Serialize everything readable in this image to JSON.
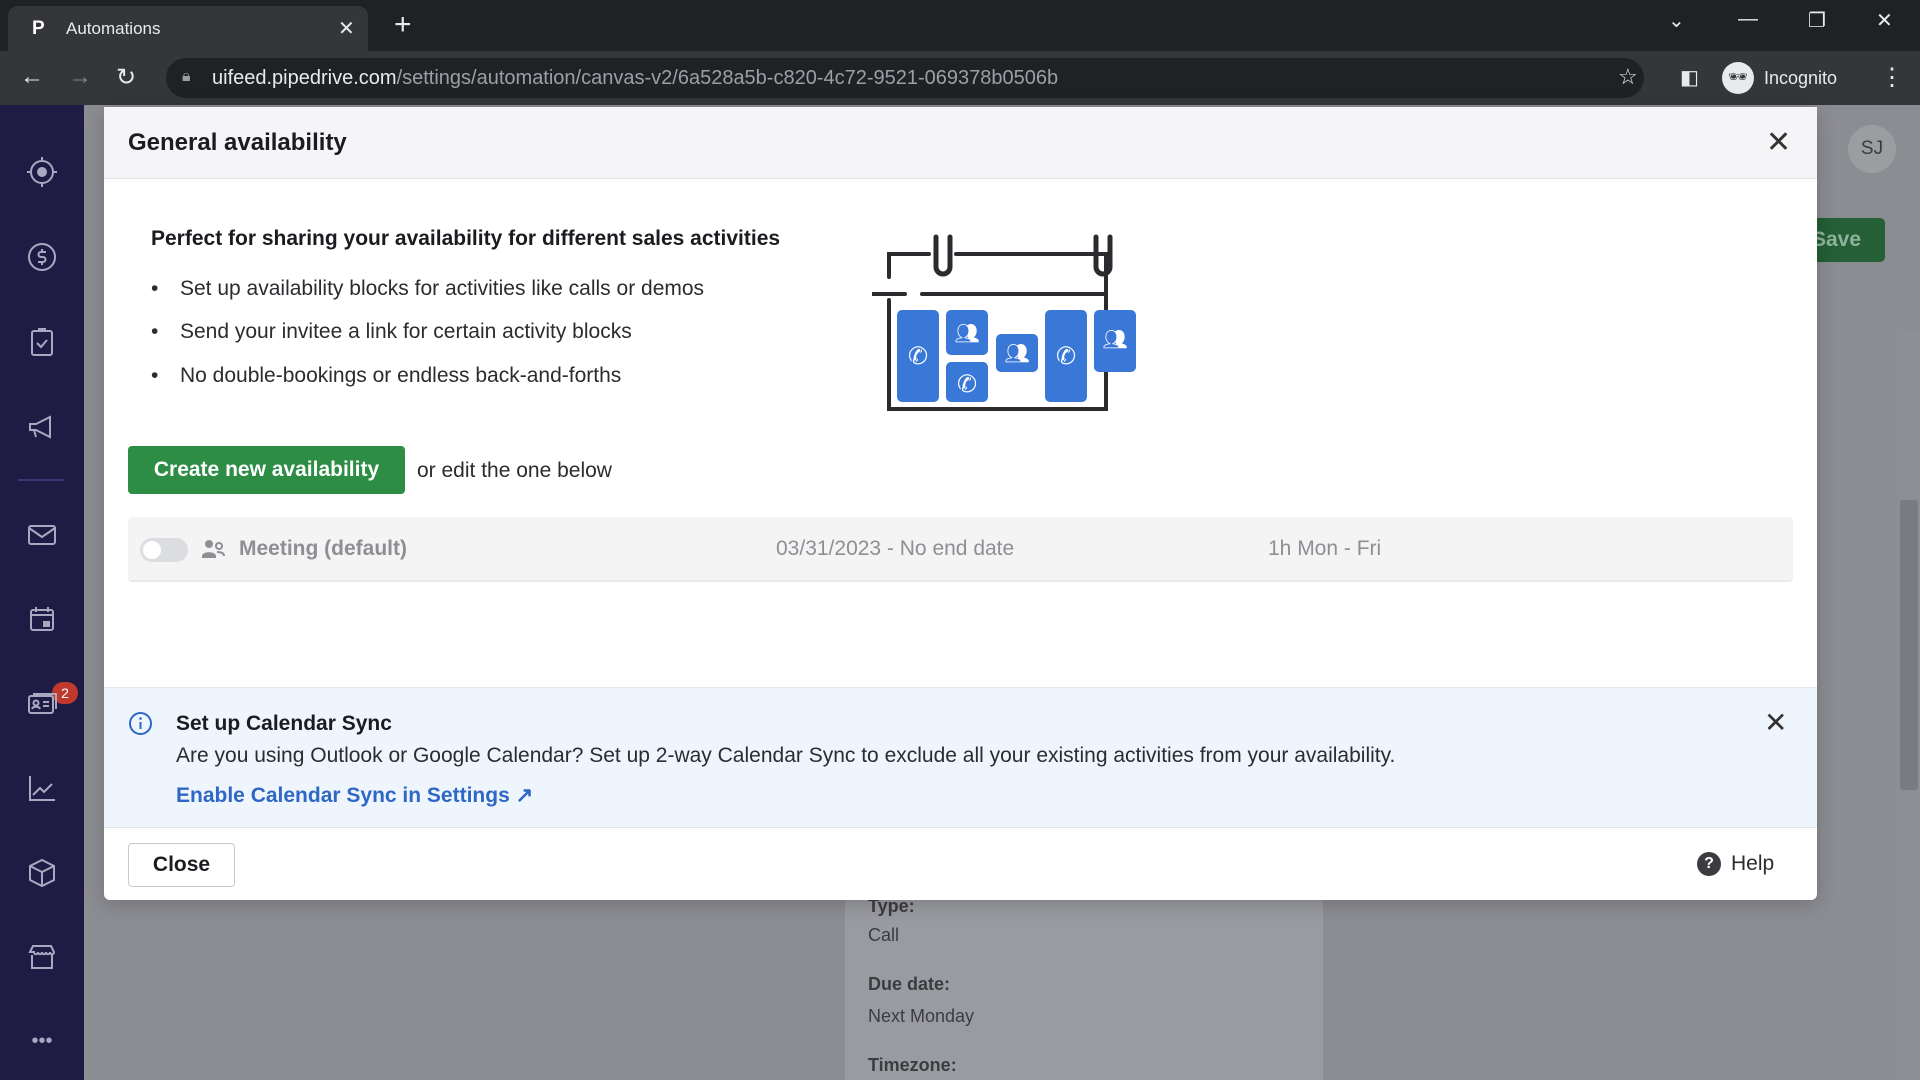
{
  "browser": {
    "tab_title": "Automations",
    "favicon": "P",
    "url_host": "uifeed.pipedrive.com",
    "url_path": "/settings/automation/canvas-v2/6a528a5b-c820-4c72-9521-069378b0506b",
    "profile": "Incognito"
  },
  "sidebar": {
    "items": [
      {
        "icon": "focus-icon"
      },
      {
        "icon": "deals-dollar-icon"
      },
      {
        "icon": "activities-clipboard-icon"
      },
      {
        "icon": "campaigns-megaphone-icon"
      },
      {
        "icon": "mail-icon"
      },
      {
        "icon": "calendar-icon",
        "badge": "2"
      },
      {
        "icon": "contacts-card-icon"
      },
      {
        "icon": "insights-chart-icon"
      },
      {
        "icon": "products-box-icon"
      },
      {
        "icon": "marketplace-store-icon"
      },
      {
        "icon": "more-icon"
      }
    ]
  },
  "background": {
    "avatar": "SJ",
    "save_label": "Save",
    "type_label": "Type:",
    "type_value": "Call",
    "due_label": "Due date:",
    "due_value": "Next Monday",
    "timezone_label": "Timezone:"
  },
  "modal": {
    "title": "General availability",
    "intro": "Perfect for sharing your availability for different sales activities",
    "bullets": [
      "Set up availability blocks for activities like calls or demos",
      "Send your invitee a link for certain activity blocks",
      "No double-bookings or endless back-and-forths"
    ],
    "create_label": "Create new availability",
    "or_edit": "or edit the one below",
    "availability": {
      "name": "Meeting (default)",
      "dates": "03/31/2023 - No end date",
      "duration": "1h Mon - Fri",
      "enabled": false
    },
    "banner": {
      "title": "Set up Calendar Sync",
      "text": "Are you using Outlook or Google Calendar? Set up 2-way Calendar Sync to exclude all your existing activities from your availability.",
      "link": "Enable Calendar Sync in Settings ↗"
    },
    "close_label": "Close",
    "help_label": "Help"
  },
  "colors": {
    "primary_green": "#2d8d45",
    "link_blue": "#2f67c4",
    "sidebar": "#1f1b45",
    "illustration_blue": "#3a78d8"
  }
}
